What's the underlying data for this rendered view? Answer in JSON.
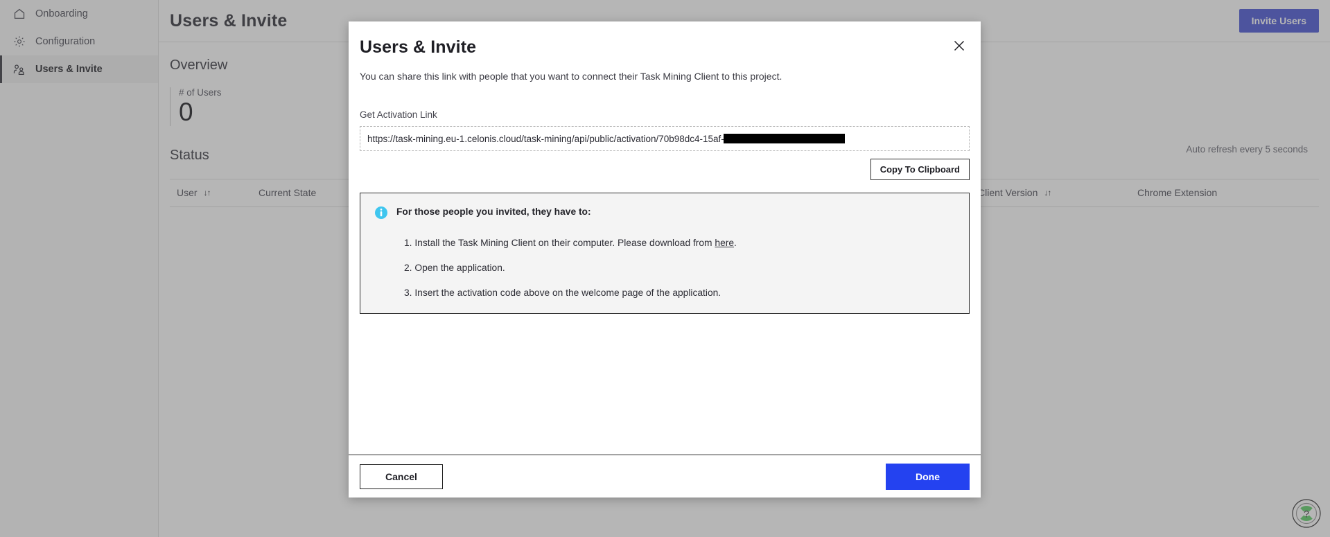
{
  "sidebar": {
    "items": [
      {
        "label": "Onboarding",
        "icon": "home-icon",
        "active": false
      },
      {
        "label": "Configuration",
        "icon": "gear-icon",
        "active": false
      },
      {
        "label": "Users & Invite",
        "icon": "users-icon",
        "active": true
      }
    ]
  },
  "header": {
    "title": "Users & Invite",
    "invite_button": "Invite Users"
  },
  "overview": {
    "section_title": "Overview",
    "users_label": "# of Users",
    "users_value": "0"
  },
  "status": {
    "section_title": "Status",
    "auto_refresh": "Auto refresh every 5 seconds",
    "columns": [
      {
        "label": "User",
        "sortable": true
      },
      {
        "label": "Current State",
        "sortable": false
      },
      {
        "label": "Client Version",
        "sortable": true
      },
      {
        "label": "Chrome Extension",
        "sortable": false
      }
    ],
    "sort_glyph": "↓↑"
  },
  "modal": {
    "title": "Users & Invite",
    "description": "You can share this link with people that you want to connect their Task Mining Client to this project.",
    "field_label": "Get Activation Link",
    "link_value": "https://task-mining.eu-1.celonis.cloud/task-mining/api/public/activation/70b98dc4-15af-",
    "copy_button": "Copy To Clipboard",
    "info": {
      "heading": "For those people you invited, they have to:",
      "step1_before": "1. Install the Task Mining Client on their computer. Please download from ",
      "step1_link": "here",
      "step1_after": ".",
      "step2": "2. Open the application.",
      "step3": "3. Insert the activation code above on the welcome page of the application."
    },
    "cancel_button": "Cancel",
    "done_button": "Done"
  },
  "help": {
    "glyph": "?"
  },
  "colors": {
    "primary_blue": "#2442f0",
    "invite_blue": "#4a56d6",
    "info_cyan": "#3fc6ef",
    "help_green": "#5fcf6a"
  }
}
